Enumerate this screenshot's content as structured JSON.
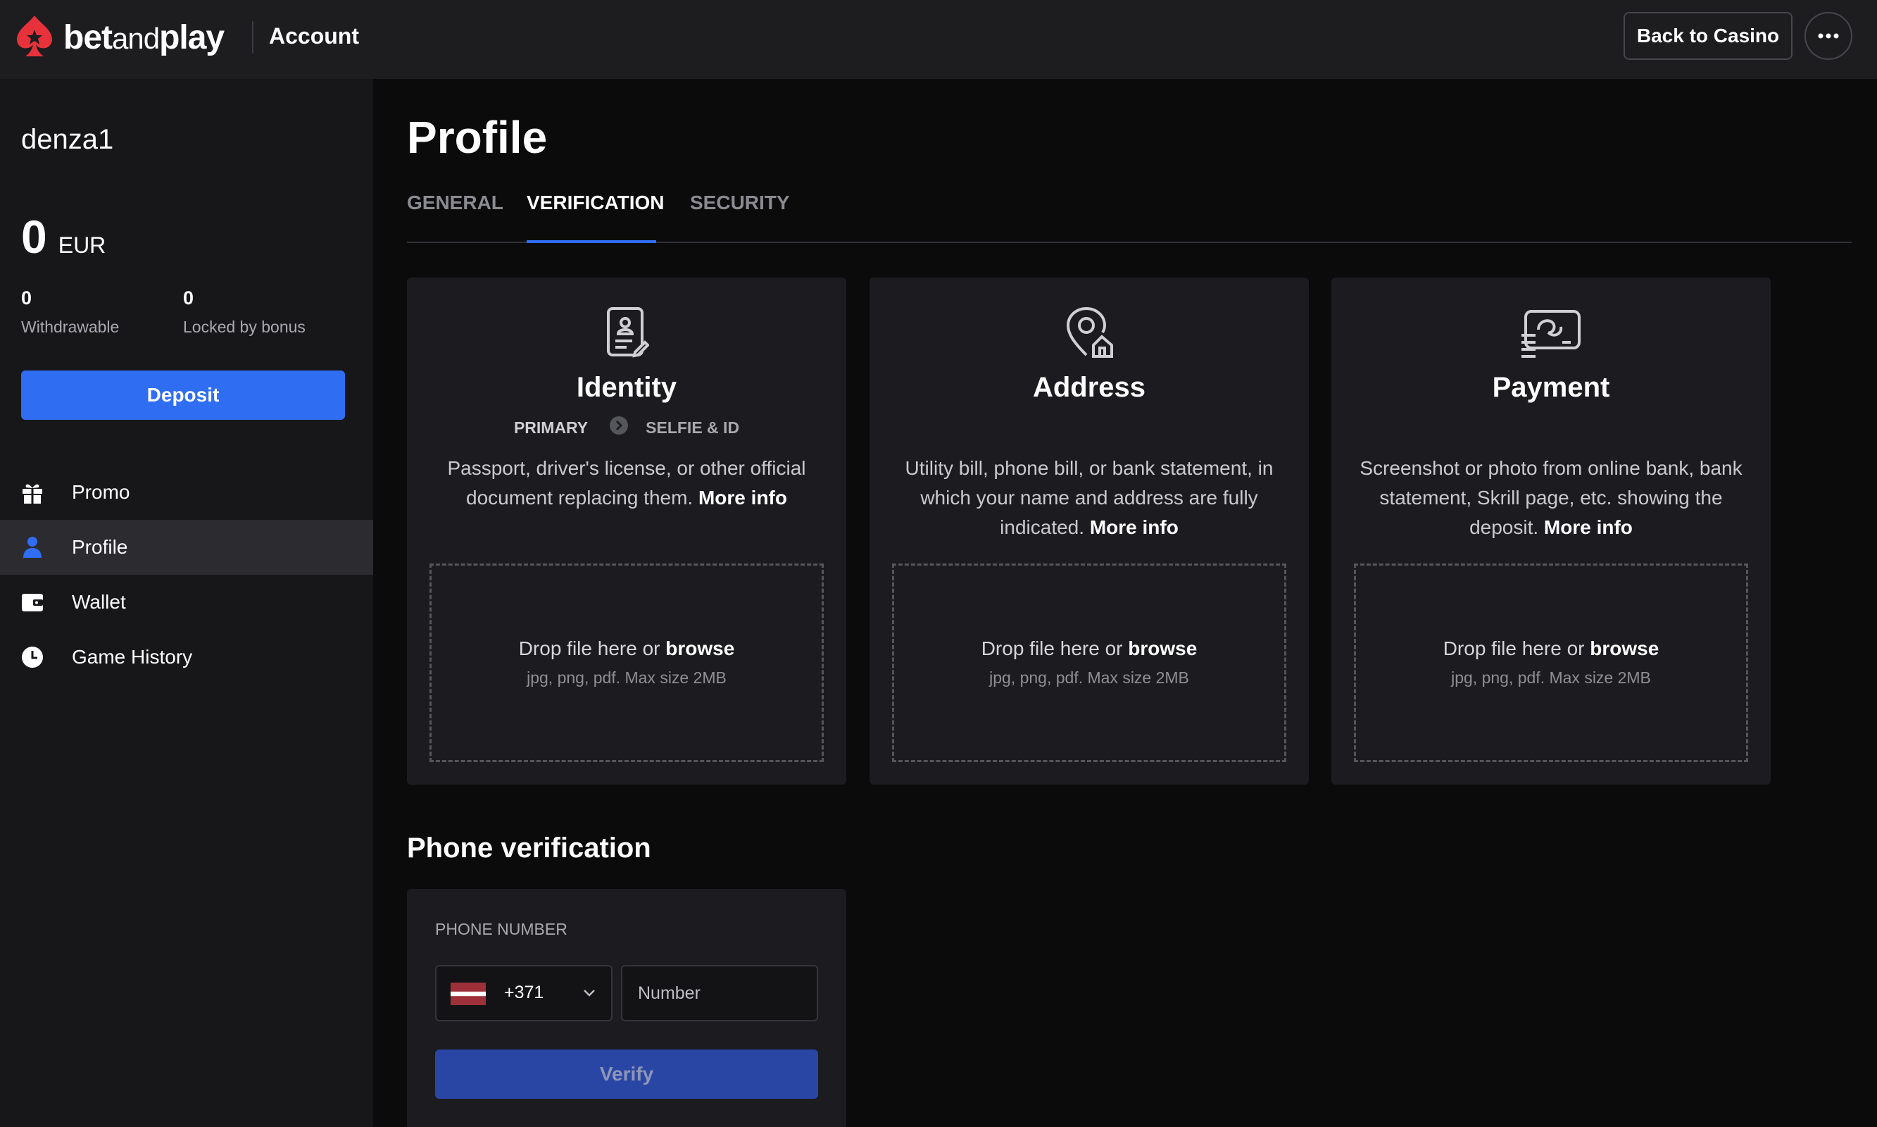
{
  "header": {
    "logo": {
      "bet": "bet",
      "and": "and",
      "play": "play"
    },
    "title": "Account",
    "back_label": "Back to Casino",
    "more_icon": "more-horizontal-icon"
  },
  "sidebar": {
    "username": "denza1",
    "balance": {
      "amount": "0",
      "currency": "EUR"
    },
    "withdrawable": {
      "value": "0",
      "label": "Withdrawable"
    },
    "locked": {
      "value": "0",
      "label": "Locked by bonus"
    },
    "deposit_label": "Deposit",
    "items": [
      {
        "label": "Promo",
        "icon": "gift-icon"
      },
      {
        "label": "Profile",
        "icon": "user-icon",
        "active": true
      },
      {
        "label": "Wallet",
        "icon": "wallet-icon"
      },
      {
        "label": "Game History",
        "icon": "clock-icon"
      }
    ]
  },
  "main": {
    "title": "Profile",
    "tabs": [
      {
        "label": "GENERAL"
      },
      {
        "label": "VERIFICATION",
        "active": true
      },
      {
        "label": "SECURITY"
      }
    ],
    "cards": [
      {
        "title": "Identity",
        "icon": "id-document-icon",
        "step_primary": "PRIMARY",
        "step_next": "SELFIE & ID",
        "desc": "Passport, driver's license, or other official document replacing them.",
        "more": "More info",
        "drop_text": "Drop file here or",
        "browse": "browse",
        "hint": "jpg, png, pdf. Max size 2MB"
      },
      {
        "title": "Address",
        "icon": "location-home-icon",
        "desc": "Utility bill, phone bill, or bank statement, in which your name and address are fully indicated.",
        "more": "More info",
        "drop_text": "Drop file here or",
        "browse": "browse",
        "hint": "jpg, png, pdf. Max size 2MB"
      },
      {
        "title": "Payment",
        "icon": "payment-card-icon",
        "desc": "Screenshot or photo from online bank, bank statement, Skrill page, etc. showing the deposit.",
        "more": "More info",
        "drop_text": "Drop file here or",
        "browse": "browse",
        "hint": "jpg, png, pdf. Max size 2MB"
      }
    ],
    "phone": {
      "heading": "Phone verification",
      "label": "PHONE NUMBER",
      "country_code": "+371",
      "number_placeholder": "Number",
      "verify_label": "Verify"
    }
  },
  "colors": {
    "accent": "#2f6ef2",
    "brand_red": "#e8323b",
    "header_bg": "#1d1d20",
    "sidebar_bg": "#17171a",
    "card_bg": "#1c1c20"
  }
}
